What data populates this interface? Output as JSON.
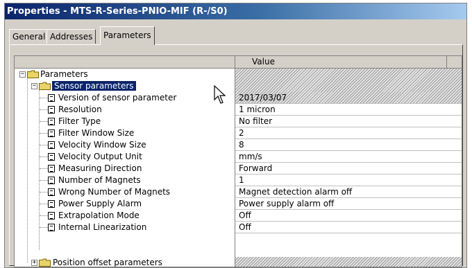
{
  "window": {
    "title": "Properties - MTS-R-Series-PNIO-MIF  (R-/S0)"
  },
  "tabs": [
    {
      "label": "General"
    },
    {
      "label": "Addresses"
    },
    {
      "label": "Parameters"
    }
  ],
  "grid": {
    "value_header": "Value",
    "root": {
      "label": "Parameters"
    },
    "group": {
      "label": "Sensor parameters"
    },
    "rows": [
      {
        "label": "Version of sensor parameter",
        "value": "2017/03/07"
      },
      {
        "label": "Resolution",
        "value": "1 micron"
      },
      {
        "label": "Filter Type",
        "value": "No filter"
      },
      {
        "label": "Filter Window Size",
        "value": "2"
      },
      {
        "label": "Velocity Window Size",
        "value": "8"
      },
      {
        "label": "Velocity Output Unit",
        "value": "mm/s"
      },
      {
        "label": "Measuring Direction",
        "value": "Forward"
      },
      {
        "label": "Number of Magnets",
        "value": "1"
      },
      {
        "label": "Wrong Number of Magnets",
        "value": "Magnet detection alarm off"
      },
      {
        "label": "Power Supply Alarm",
        "value": "Power supply alarm off"
      },
      {
        "label": "Extrapolation Mode",
        "value": "Off"
      },
      {
        "label": "Internal Linearization",
        "value": "Off"
      }
    ],
    "collapsed_group": {
      "label": "Position offset parameters"
    }
  },
  "icons": {
    "folder": "folder-icon",
    "parameter": "parameter-icon",
    "expand": "expand-icon",
    "collapse": "collapse-icon",
    "cursor": "mouse-cursor-icon"
  },
  "colors": {
    "titlebar_start": "#0a246a",
    "selection": "#0a246a",
    "dialog_bg": "#d4d0c8"
  }
}
